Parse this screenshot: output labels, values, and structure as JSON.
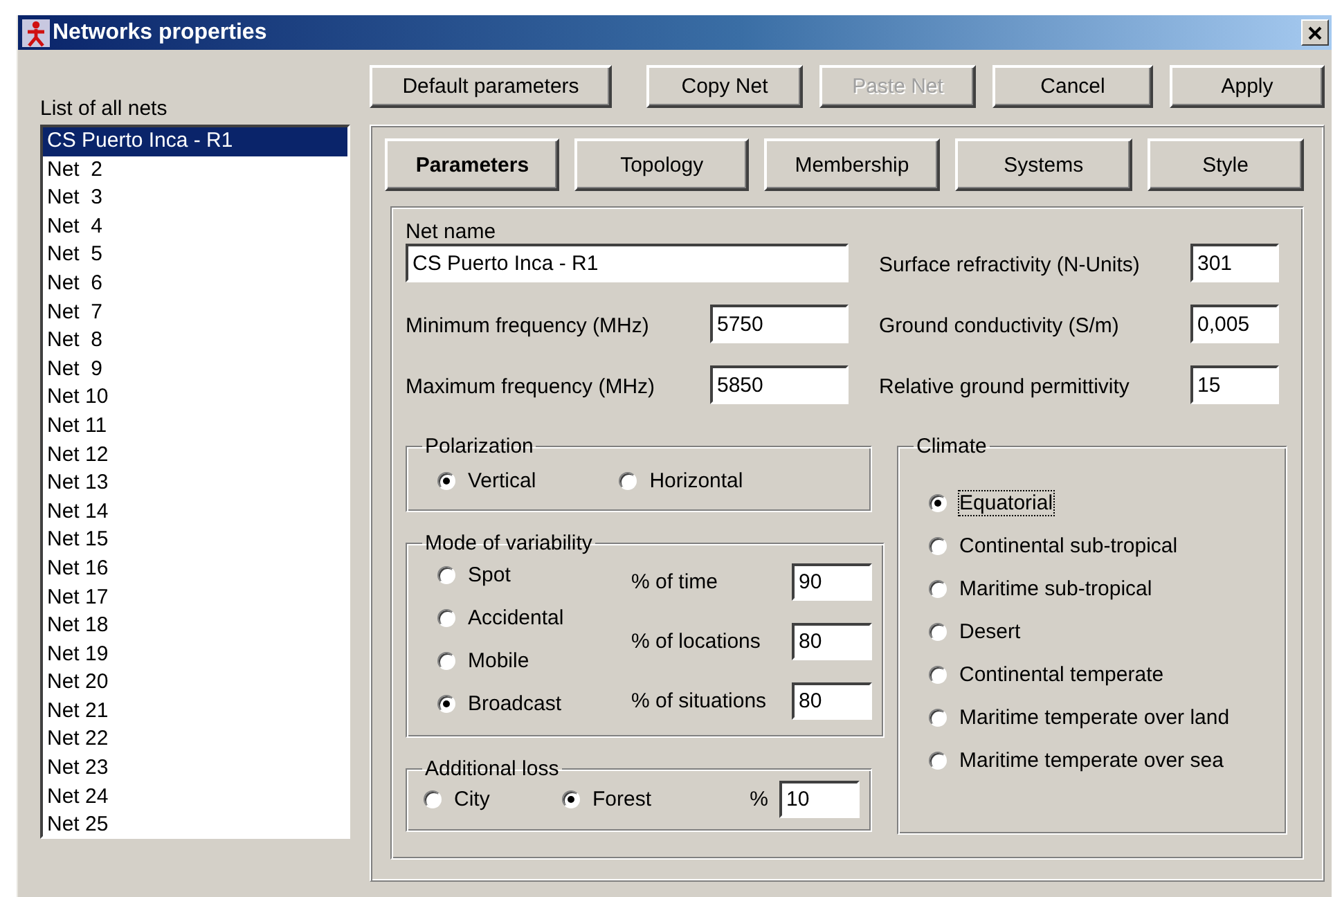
{
  "window": {
    "title": "Networks properties"
  },
  "actions": [
    {
      "label": "Default parameters",
      "disabled": false
    },
    {
      "label": "Copy Net",
      "disabled": false
    },
    {
      "label": "Paste Net",
      "disabled": true
    },
    {
      "label": "Cancel",
      "disabled": false
    },
    {
      "label": "Apply",
      "disabled": false
    }
  ],
  "net_list": {
    "label": "List of all nets",
    "items": [
      {
        "label": "CS Puerto Inca - R1",
        "selected": true
      },
      {
        "label": "Net  2",
        "selected": false
      },
      {
        "label": "Net  3",
        "selected": false
      },
      {
        "label": "Net  4",
        "selected": false
      },
      {
        "label": "Net  5",
        "selected": false
      },
      {
        "label": "Net  6",
        "selected": false
      },
      {
        "label": "Net  7",
        "selected": false
      },
      {
        "label": "Net  8",
        "selected": false
      },
      {
        "label": "Net  9",
        "selected": false
      },
      {
        "label": "Net 10",
        "selected": false
      },
      {
        "label": "Net 11",
        "selected": false
      },
      {
        "label": "Net 12",
        "selected": false
      },
      {
        "label": "Net 13",
        "selected": false
      },
      {
        "label": "Net 14",
        "selected": false
      },
      {
        "label": "Net 15",
        "selected": false
      },
      {
        "label": "Net 16",
        "selected": false
      },
      {
        "label": "Net 17",
        "selected": false
      },
      {
        "label": "Net 18",
        "selected": false
      },
      {
        "label": "Net 19",
        "selected": false
      },
      {
        "label": "Net 20",
        "selected": false
      },
      {
        "label": "Net 21",
        "selected": false
      },
      {
        "label": "Net 22",
        "selected": false
      },
      {
        "label": "Net 23",
        "selected": false
      },
      {
        "label": "Net 24",
        "selected": false
      },
      {
        "label": "Net 25",
        "selected": false
      }
    ]
  },
  "tabs": [
    {
      "label": "Parameters",
      "selected": true
    },
    {
      "label": "Topology",
      "selected": false
    },
    {
      "label": "Membership",
      "selected": false
    },
    {
      "label": "Systems",
      "selected": false
    },
    {
      "label": "Style",
      "selected": false
    }
  ],
  "parameters": {
    "net_name": {
      "label": "Net name",
      "value": "CS Puerto Inca - R1"
    },
    "fields_left": [
      {
        "label": "Minimum frequency (MHz)",
        "value": "5750"
      },
      {
        "label": "Maximum frequency (MHz)",
        "value": "5850"
      }
    ],
    "fields_right": [
      {
        "label": "Surface refractivity (N-Units)",
        "value": "301"
      },
      {
        "label": "Ground conductivity (S/m)",
        "value": "0,005"
      },
      {
        "label": "Relative ground permittivity",
        "value": "15"
      }
    ],
    "polarization": {
      "title": "Polarization",
      "options": [
        {
          "label": "Vertical",
          "selected": true
        },
        {
          "label": "Horizontal",
          "selected": false
        }
      ]
    },
    "variability": {
      "title": "Mode of variability",
      "options": [
        {
          "label": "Spot",
          "selected": false
        },
        {
          "label": "Accidental",
          "selected": false
        },
        {
          "label": "Mobile",
          "selected": false
        },
        {
          "label": "Broadcast",
          "selected": true
        }
      ],
      "fields": [
        {
          "label": "% of time",
          "value": "90"
        },
        {
          "label": "% of locations",
          "value": "80"
        },
        {
          "label": "% of situations",
          "value": "80"
        }
      ]
    },
    "additional_loss": {
      "title": "Additional loss",
      "options": [
        {
          "label": "City",
          "selected": false
        },
        {
          "label": "Forest",
          "selected": true
        }
      ],
      "field": {
        "label": "%",
        "value": "10"
      }
    },
    "climate": {
      "title": "Climate",
      "options": [
        {
          "label": "Equatorial",
          "selected": true,
          "focused": true
        },
        {
          "label": "Continental sub-tropical",
          "selected": false,
          "focused": false
        },
        {
          "label": "Maritime sub-tropical",
          "selected": false,
          "focused": false
        },
        {
          "label": "Desert",
          "selected": false,
          "focused": false
        },
        {
          "label": "Continental temperate",
          "selected": false,
          "focused": false
        },
        {
          "label": "Maritime temperate over land",
          "selected": false,
          "focused": false
        },
        {
          "label": "Maritime temperate over sea",
          "selected": false,
          "focused": false
        }
      ]
    }
  }
}
